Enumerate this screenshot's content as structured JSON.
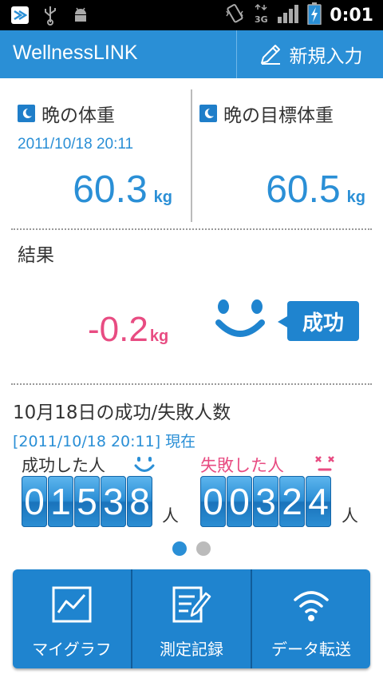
{
  "status_bar": {
    "time": "0:01"
  },
  "app": {
    "title": "WellnessLINK",
    "new_entry_label": "新規入力"
  },
  "current_weight": {
    "label": "晩の体重",
    "datetime": "2011/10/18 20:11",
    "value": "60.3",
    "unit": "kg"
  },
  "target_weight": {
    "label": "晩の目標体重",
    "value": "60.5",
    "unit": "kg"
  },
  "result": {
    "label": "結果",
    "difference": "-0.2",
    "unit": "kg",
    "status": "成功"
  },
  "counts": {
    "title": "10月18日の成功/失敗人数",
    "as_of": "[2011/10/18 20:11] 現在",
    "success_label": "成功した人",
    "success_digits": [
      "0",
      "1",
      "5",
      "3",
      "8"
    ],
    "failure_label": "失敗した人",
    "failure_digits": [
      "0",
      "0",
      "3",
      "2",
      "4"
    ],
    "person_unit": "人"
  },
  "pager": {
    "pages": 2,
    "active": 1
  },
  "bottom_nav": {
    "my_graph": "マイグラフ",
    "records": "測定記録",
    "transfer": "データ転送"
  },
  "colors": {
    "accent": "#2a8fd6",
    "failure": "#e84c82",
    "header": "#2a8fd6"
  }
}
